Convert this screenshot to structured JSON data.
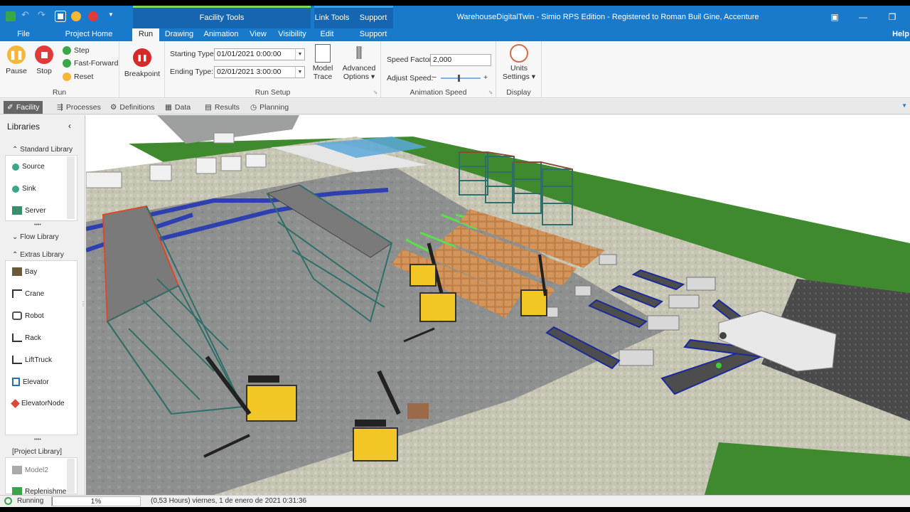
{
  "titlebar": {
    "window_title": "WarehouseDigitalTwin - Simio RPS Edition - Registered to Roman Buil Gine, Accenture",
    "contextual_tools": "Facility Tools",
    "link_tools": "Link Tools",
    "support_context": "Support"
  },
  "tabs": [
    "File",
    "Project Home",
    "Run",
    "Drawing",
    "Animation",
    "View",
    "Visibility",
    "Edit",
    "Support",
    "Help"
  ],
  "ribbon": {
    "run_group": {
      "pause": "Pause",
      "stop": "Stop",
      "step": "Step",
      "fast_forward": "Fast-Forward",
      "reset": "Reset",
      "label": "Run"
    },
    "breakpoint": "Breakpoint",
    "run_setup": {
      "starting_type_label": "Starting Type:",
      "starting_value": "01/01/2021 0:00:00",
      "ending_type_label": "Ending Type:",
      "ending_value": "02/01/2021 3:00:00",
      "model_trace_1": "Model",
      "model_trace_2": "Trace",
      "advanced_1": "Advanced",
      "advanced_2": "Options ▾",
      "label": "Run Setup"
    },
    "animation_speed": {
      "speed_factor_label": "Speed Factor:",
      "speed_factor_value": "2,000",
      "adjust_speed_label": "Adjust Speed:",
      "minus": "−",
      "plus": "+",
      "label": "Animation Speed"
    },
    "display": {
      "units_1": "Units",
      "units_2": "Settings ▾",
      "label": "Display"
    }
  },
  "view_tabs": [
    "Facility",
    "Processes",
    "Definitions",
    "Data",
    "Results",
    "Planning"
  ],
  "libraries": {
    "title": "Libraries",
    "standard": "Standard Library",
    "standard_items": [
      "Source",
      "Sink",
      "Server"
    ],
    "flow": "Flow Library",
    "extras": "Extras Library",
    "extras_items": [
      "Bay",
      "Crane",
      "Robot",
      "Rack",
      "LiftTruck",
      "Elevator",
      "ElevatorNode"
    ],
    "project": "[Project Library]",
    "project_items": [
      "Model2",
      "Replenishme"
    ],
    "dots": "••••"
  },
  "status": {
    "state": "Running",
    "progress_text": "1%",
    "progress": 0.01,
    "time": "(0,53 Hours) viernes, 1 de enero de 2021 0:31:36"
  },
  "colors": {
    "accent": "#1979ca",
    "context_green": "#7ed957",
    "grass": "#3f8a2e",
    "floor": "#8f9190",
    "cobble": "#c9c8b8",
    "forklift": "#f2c624"
  }
}
